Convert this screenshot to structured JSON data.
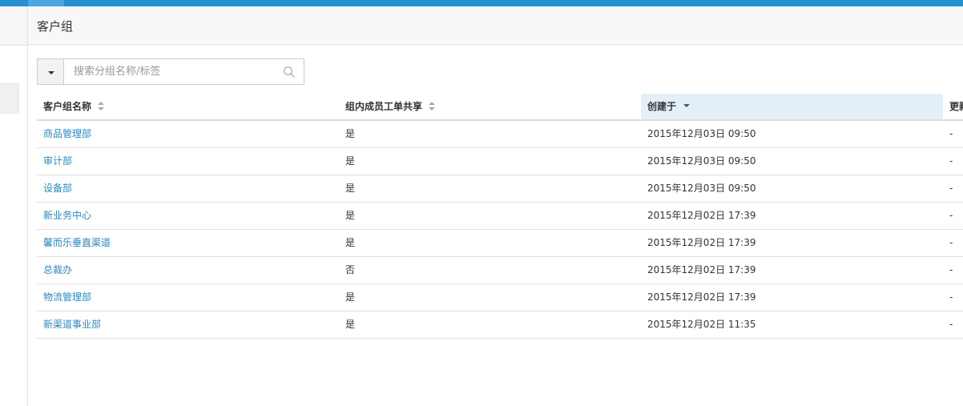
{
  "header": {
    "title": "客户组"
  },
  "search": {
    "placeholder": "搜索分组名称/标签",
    "value": ""
  },
  "table": {
    "columns": [
      {
        "label": "客户组名称",
        "sort": "none"
      },
      {
        "label": "组内成员工单共享",
        "sort": "none"
      },
      {
        "label": "创建于",
        "sort": "desc"
      },
      {
        "label": "更新",
        "sort": "none"
      }
    ],
    "rows": [
      {
        "name": "商品管理部",
        "shared": "是",
        "created": "2015年12月03日 09:50",
        "updated": "-"
      },
      {
        "name": "审计部",
        "shared": "是",
        "created": "2015年12月03日 09:50",
        "updated": "-"
      },
      {
        "name": "设备部",
        "shared": "是",
        "created": "2015年12月03日 09:50",
        "updated": "-"
      },
      {
        "name": "新业务中心",
        "shared": "是",
        "created": "2015年12月02日 17:39",
        "updated": "-"
      },
      {
        "name": "馨而乐垂直渠道",
        "shared": "是",
        "created": "2015年12月02日 17:39",
        "updated": "-"
      },
      {
        "name": "总裁办",
        "shared": "否",
        "created": "2015年12月02日 17:39",
        "updated": "-"
      },
      {
        "name": "物流管理部",
        "shared": "是",
        "created": "2015年12月02日 17:39",
        "updated": "-"
      },
      {
        "name": "新渠道事业部",
        "shared": "是",
        "created": "2015年12月02日 11:35",
        "updated": "-"
      }
    ]
  },
  "colors": {
    "topbar": "#2590d0",
    "link": "#2a88c0",
    "sorted_header_bg": "#e3f0f9"
  },
  "icons": {
    "search": "search-icon",
    "dropdown": "caret-down-icon",
    "sort": "sort-icon",
    "sort_desc": "sort-desc-icon"
  }
}
